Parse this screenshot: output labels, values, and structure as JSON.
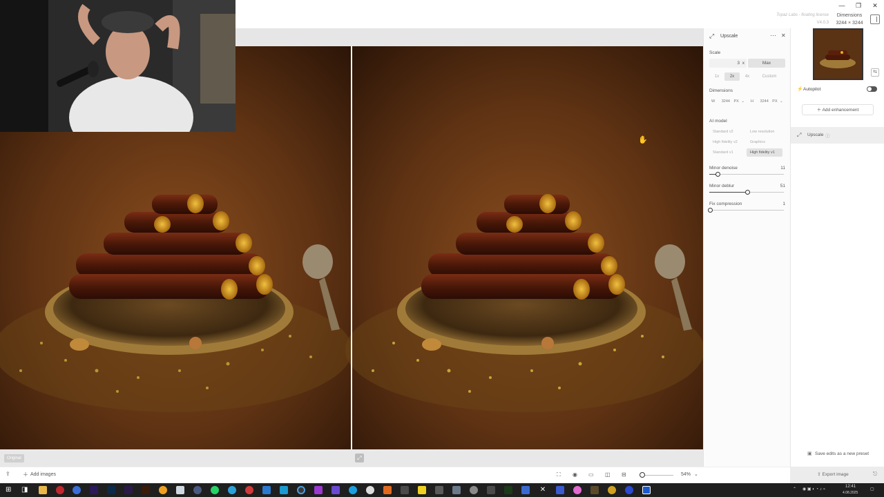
{
  "app": {
    "watermark": "Topaz Labs - floating license",
    "version": "V4.0.3",
    "dimensions_label": "Dimensions",
    "dimensions_value": "3244 × 3244"
  },
  "canvas": {
    "original_badge": "Original"
  },
  "settings": {
    "title": "Upscale",
    "scale_label": "Scale",
    "scale_value": "3",
    "scale_unit": "x",
    "max_button": "Max",
    "scale_options": [
      "1x",
      "2x",
      "4x",
      "Custom"
    ],
    "dimensions_label": "Dimensions",
    "width_label": "W",
    "width_value": "3244",
    "width_unit": "PX",
    "height_label": "H",
    "height_value": "3244",
    "height_unit": "PX",
    "ai_model_label": "AI model",
    "models": [
      "Standard v2",
      "Low resolution",
      "High fidelity v2",
      "Graphics",
      "Standard v1",
      "High fidelity v1"
    ],
    "selected_model": "High fidelity v1",
    "sliders": [
      {
        "label": "Minor denoise",
        "value": "11",
        "fraction": 0.11
      },
      {
        "label": "Minor deblur",
        "value": "51",
        "fraction": 0.51
      },
      {
        "label": "Fix compression",
        "value": "1",
        "fraction": 0.01
      }
    ]
  },
  "right_panel": {
    "autopilot_label": "Autopilot",
    "add_enhancement": "Add enhancement",
    "enhancement_item": "Upscale",
    "save_preset": "Save edits as a new preset",
    "export": "Export image"
  },
  "bottombar": {
    "add_images": "Add images",
    "zoom": "54%"
  },
  "taskbar": {
    "time": "12:41",
    "date": "4.08.2025"
  },
  "colors": {
    "accent": "#333333",
    "canvas_bg": "#3a1e0c"
  }
}
